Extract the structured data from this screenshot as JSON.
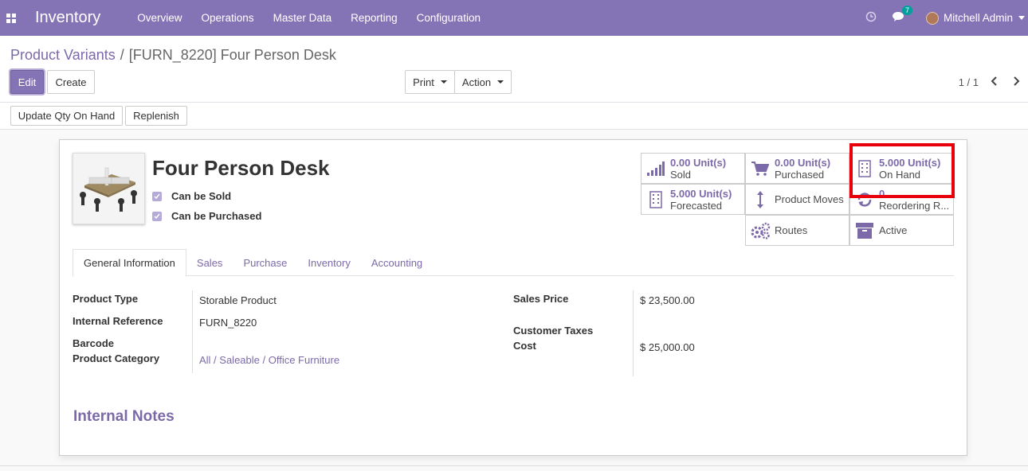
{
  "navbar": {
    "brand": "Inventory",
    "menu": [
      "Overview",
      "Operations",
      "Master Data",
      "Reporting",
      "Configuration"
    ],
    "message_count": "7",
    "user_name": "Mitchell Admin"
  },
  "breadcrumb": {
    "parent": "Product Variants",
    "separator": "/",
    "current": "[FURN_8220] Four Person Desk"
  },
  "buttons": {
    "edit": "Edit",
    "create": "Create",
    "print": "Print",
    "action": "Action",
    "update_qty": "Update Qty On Hand",
    "replenish": "Replenish"
  },
  "pager": {
    "value": "1 / 1"
  },
  "product": {
    "name": "Four Person Desk",
    "can_be_sold": "Can be Sold",
    "can_be_purchased": "Can be Purchased"
  },
  "smart_buttons": {
    "sold": {
      "value": "0.00",
      "unit": "Unit(s)",
      "label": "Sold"
    },
    "purchased": {
      "value": "0.00",
      "unit": "Unit(s)",
      "label": "Purchased"
    },
    "on_hand": {
      "value": "5.000",
      "unit": "Unit(s)",
      "label": "On Hand"
    },
    "forecasted": {
      "value": "5.000",
      "unit": "Unit(s)",
      "label": "Forecasted"
    },
    "product_moves": {
      "label": "Product Moves"
    },
    "reordering": {
      "value": "0",
      "label": "Reordering R..."
    },
    "routes": {
      "label": "Routes"
    },
    "active": {
      "label": "Active"
    }
  },
  "tabs": [
    "General Information",
    "Sales",
    "Purchase",
    "Inventory",
    "Accounting"
  ],
  "general": {
    "product_type_label": "Product Type",
    "product_type": "Storable Product",
    "internal_ref_label": "Internal Reference",
    "internal_ref": "FURN_8220",
    "barcode_label": "Barcode",
    "category_label": "Product Category",
    "category": "All / Saleable / Office Furniture",
    "sales_price_label": "Sales Price",
    "sales_price": "$ 23,500.00",
    "customer_taxes_label": "Customer Taxes",
    "cost_label": "Cost",
    "cost": "$ 25,000.00"
  },
  "notes_title": "Internal Notes",
  "colors": {
    "navbar": "#8574b5",
    "link": "#7c6aa8",
    "highlight": "#e8000a",
    "active": "#28a745"
  }
}
